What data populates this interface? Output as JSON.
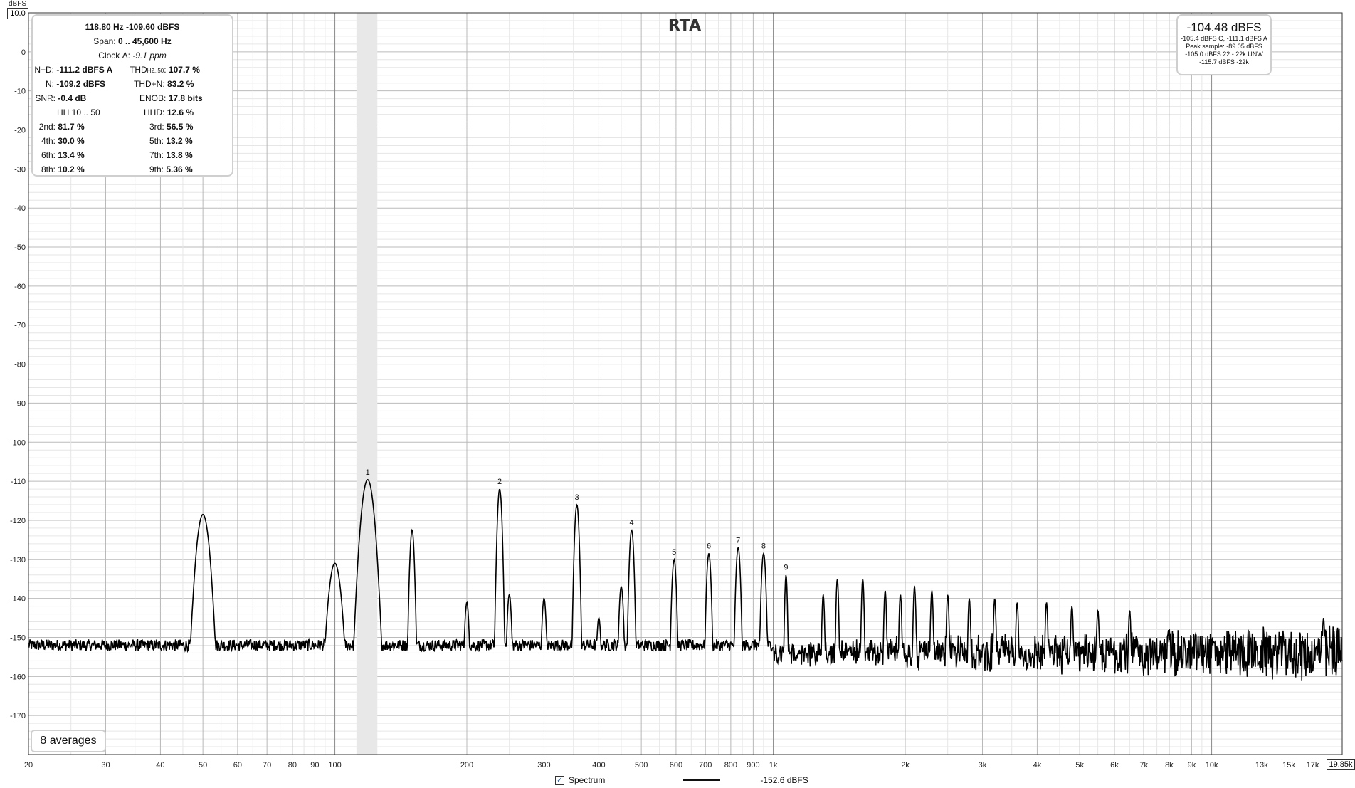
{
  "chart_data": {
    "type": "line",
    "title": "RTA",
    "ylabel": "dBFS",
    "ylim": [
      -180,
      10
    ],
    "xlim": [
      20,
      19850
    ],
    "x_scale": "log",
    "y_ticks": [
      0,
      -10,
      -20,
      -30,
      -40,
      -50,
      -60,
      -70,
      -80,
      -90,
      -100,
      -110,
      -120,
      -130,
      -140,
      -150,
      -160,
      -170
    ],
    "y_max_label": "10.0",
    "x_ticks": [
      {
        "v": 20,
        "t": "20"
      },
      {
        "v": 30,
        "t": "30"
      },
      {
        "v": 40,
        "t": "40"
      },
      {
        "v": 50,
        "t": "50"
      },
      {
        "v": 60,
        "t": "60"
      },
      {
        "v": 70,
        "t": "70"
      },
      {
        "v": 80,
        "t": "80"
      },
      {
        "v": 90,
        "t": "90"
      },
      {
        "v": 100,
        "t": "100"
      },
      {
        "v": 200,
        "t": "200"
      },
      {
        "v": 300,
        "t": "300"
      },
      {
        "v": 400,
        "t": "400"
      },
      {
        "v": 500,
        "t": "500"
      },
      {
        "v": 600,
        "t": "600"
      },
      {
        "v": 700,
        "t": "700"
      },
      {
        "v": 800,
        "t": "800"
      },
      {
        "v": 900,
        "t": "900"
      },
      {
        "v": 1000,
        "t": "1k"
      },
      {
        "v": 2000,
        "t": "2k"
      },
      {
        "v": 3000,
        "t": "3k"
      },
      {
        "v": 4000,
        "t": "4k"
      },
      {
        "v": 5000,
        "t": "5k"
      },
      {
        "v": 6000,
        "t": "6k"
      },
      {
        "v": 7000,
        "t": "7k"
      },
      {
        "v": 8000,
        "t": "8k"
      },
      {
        "v": 9000,
        "t": "9k"
      },
      {
        "v": 10000,
        "t": "10k"
      },
      {
        "v": 13000,
        "t": "13k"
      },
      {
        "v": 15000,
        "t": "15k"
      },
      {
        "v": 17000,
        "t": "17k"
      }
    ],
    "x_max_label": "19.85k",
    "highlight_band": [
      112,
      125
    ],
    "grid": true,
    "noise_floor": -152,
    "series": [
      {
        "name": "Spectrum",
        "level_label": "-152.6 dBFS",
        "peaks": [
          {
            "x": 50,
            "y": -118.5
          },
          {
            "x": 100,
            "y": -131
          },
          {
            "x": 118.8,
            "y": -109.6,
            "label": "1"
          },
          {
            "x": 150,
            "y": -122.5
          },
          {
            "x": 200,
            "y": -141
          },
          {
            "x": 237.6,
            "y": -112,
            "label": "2"
          },
          {
            "x": 250,
            "y": -139
          },
          {
            "x": 300,
            "y": -140
          },
          {
            "x": 356.4,
            "y": -116,
            "label": "3"
          },
          {
            "x": 400,
            "y": -145
          },
          {
            "x": 450,
            "y": -137
          },
          {
            "x": 475.2,
            "y": -122.5,
            "label": "4"
          },
          {
            "x": 594,
            "y": -130,
            "label": "5"
          },
          {
            "x": 712.8,
            "y": -128.5,
            "label": "6"
          },
          {
            "x": 831.6,
            "y": -127,
            "label": "7"
          },
          {
            "x": 950.4,
            "y": -128.5,
            "label": "8"
          },
          {
            "x": 1069.2,
            "y": -134,
            "label": "9"
          },
          {
            "x": 1300,
            "y": -139
          },
          {
            "x": 1400,
            "y": -135
          },
          {
            "x": 1600,
            "y": -135
          },
          {
            "x": 1800,
            "y": -138
          },
          {
            "x": 1950,
            "y": -139
          },
          {
            "x": 2100,
            "y": -137
          },
          {
            "x": 2300,
            "y": -138
          },
          {
            "x": 2500,
            "y": -139
          },
          {
            "x": 2800,
            "y": -140
          },
          {
            "x": 3200,
            "y": -140
          },
          {
            "x": 3600,
            "y": -141
          },
          {
            "x": 4200,
            "y": -141
          },
          {
            "x": 4800,
            "y": -142
          },
          {
            "x": 5500,
            "y": -143
          },
          {
            "x": 6500,
            "y": -143
          },
          {
            "x": 18000,
            "y": -145
          }
        ]
      }
    ]
  },
  "stats": {
    "header1": "118.80 Hz  -109.60 dBFS",
    "span_label": "Span:",
    "span_value": "0 .. 45,600 Hz",
    "clock_label": "Clock Δ:",
    "clock_value": "-9.1 ppm",
    "nd_label": "N+D:",
    "nd_value": "-111.2 dBFS A",
    "thd_label": "THD",
    "thd_sub": "H2..50",
    "thd_value": "107.7 %",
    "n_label": "N:",
    "n_value": "-109.2 dBFS",
    "thdn_label": "THD+N:",
    "thdn_value": "83.2 %",
    "snr_label": "SNR:",
    "snr_value": "-0.4 dB",
    "enob_label": "ENOB:",
    "enob_value": "17.8 bits",
    "hh_label": "HH 10 .. 50",
    "hhd_label": "HHD:",
    "hhd_value": "12.6 %",
    "h2_label": "2nd:",
    "h2": "81.7 %",
    "h3_label": "3rd:",
    "h3": "56.5 %",
    "h4_label": "4th:",
    "h4": "30.0 %",
    "h5_label": "5th:",
    "h5": "13.2 %",
    "h6_label": "6th:",
    "h6": "13.4 %",
    "h7_label": "7th:",
    "h7": "13.8 %",
    "h8_label": "8th:",
    "h8": "10.2 %",
    "h9_label": "9th:",
    "h9": "5.36 %"
  },
  "level_panel": {
    "main": "-104.48 dBFS",
    "line1": "-105.4 dBFS C, -111.1 dBFS A",
    "line2": "Peak sample: -89.05 dBFS",
    "line3": "-105.0 dBFS 22 - 22k UNW",
    "line4": "-115.7 dBFS -22k"
  },
  "averages": "8 averages",
  "legend": {
    "label": "Spectrum",
    "checked": true,
    "value": "-152.6 dBFS"
  },
  "colors": {
    "trace": "#000000",
    "grid_major": "#b8b8b8",
    "grid_minor": "#e6e6e6",
    "band": "#e8e8e8"
  }
}
